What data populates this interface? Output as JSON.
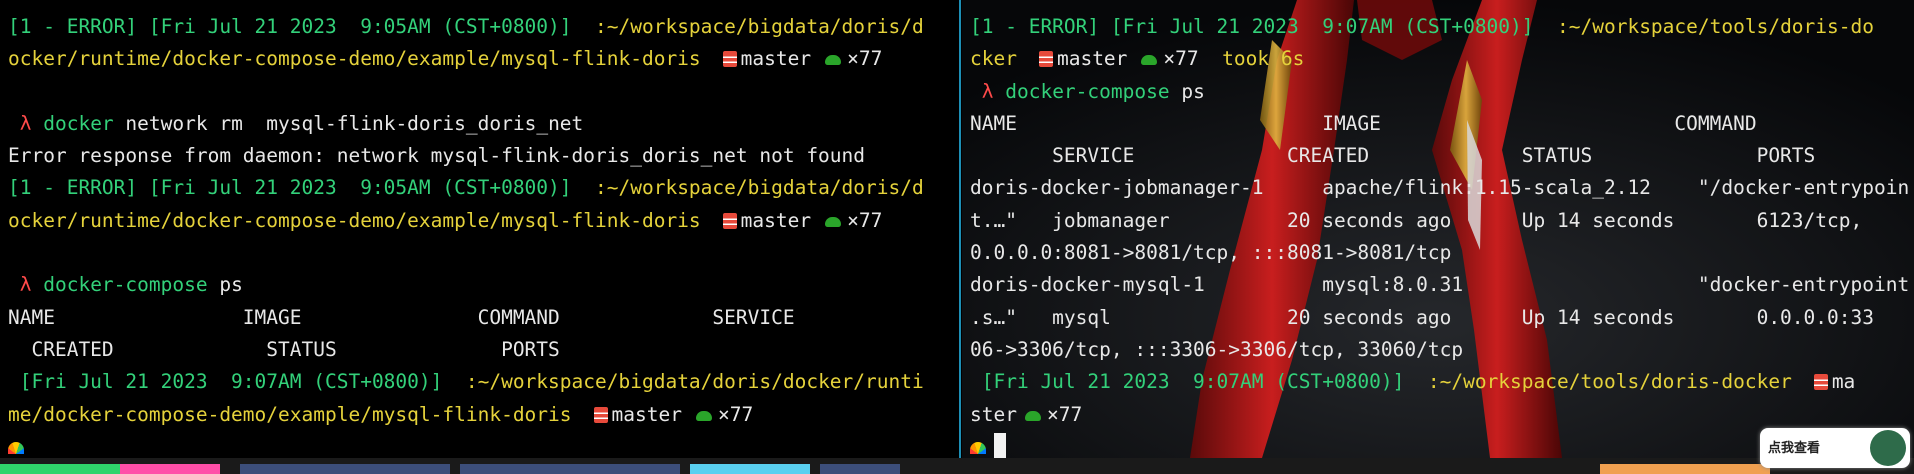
{
  "left_terminal": {
    "p1_status": "[1 - ERROR] [Fri Jul 21 2023  9:05AM (CST+0800)]",
    "p1_path_a": "  :~/workspace/bigdata/doris/d",
    "p1_path_b": "ocker/runtime/docker-compose-demo/example/mysql-flink-doris",
    "p1_branch": "master",
    "p1_count": "×77",
    "cmd1_prompt": " λ ",
    "cmd1_name": "docker",
    "cmd1_args": " network rm  mysql-flink-doris_doris_net",
    "error_line": "Error response from daemon: network mysql-flink-doris_doris_net not found",
    "p2_status": "[1 - ERROR] [Fri Jul 21 2023  9:05AM (CST+0800)]",
    "p2_path_a": "  :~/workspace/bigdata/doris/d",
    "p2_path_b": "ocker/runtime/docker-compose-demo/example/mysql-flink-doris",
    "p2_branch": "master",
    "p2_count": "×77",
    "cmd2_prompt": " λ ",
    "cmd2_name": "docker-compose",
    "cmd2_args": " ps",
    "header_row1": "NAME                IMAGE               COMMAND             SERVICE",
    "header_row2": "  CREATED             STATUS              PORTS",
    "p3_status": " [Fri Jul 21 2023  9:07AM (CST+0800)]",
    "p3_path_a": "  :~/workspace/bigdata/doris/docker/runti",
    "p3_path_b": "me/docker-compose-demo/example/mysql-flink-doris",
    "p3_branch": "master",
    "p3_count": "×77"
  },
  "right_terminal": {
    "p1_status": "[1 - ERROR] [Fri Jul 21 2023  9:07AM (CST+0800)]",
    "p1_path_a": "  :~/workspace/tools/doris-do",
    "p1_path_b": "cker",
    "p1_branch": "master",
    "p1_count": "×77",
    "p1_took": "  took 6s",
    "cmd_prompt": " λ ",
    "cmd_name": "docker-compose",
    "cmd_args": " ps",
    "rows": [
      "NAME                          IMAGE                         COMMAND",
      "       SERVICE             CREATED             STATUS              PORTS",
      "doris-docker-jobmanager-1     apache/flink:1.15-scala_2.12    \"/docker-entrypoin",
      "t.…\"   jobmanager          20 seconds ago      Up 14 seconds       6123/tcp,",
      "0.0.0.0:8081->8081/tcp, :::8081->8081/tcp",
      "doris-docker-mysql-1          mysql:8.0.31                    \"docker-entrypoint",
      ".s…\"   mysql               20 seconds ago      Up 14 seconds       0.0.0.0:33",
      "06->3306/tcp, :::3306->3306/tcp, 33060/tcp"
    ],
    "p2_status": " [Fri Jul 21 2023  9:07AM (CST+0800)]",
    "p2_path": "  :~/workspace/tools/doris-docker",
    "p2_branch_a": "ma",
    "p2_branch_b": "ster",
    "p2_count": "×77"
  },
  "watermark": {
    "label": "点我查看"
  },
  "icons": {
    "git_branch": "git-branch-icon",
    "turtle": "turtle-icon",
    "rainbow": "rainbow-icon"
  }
}
